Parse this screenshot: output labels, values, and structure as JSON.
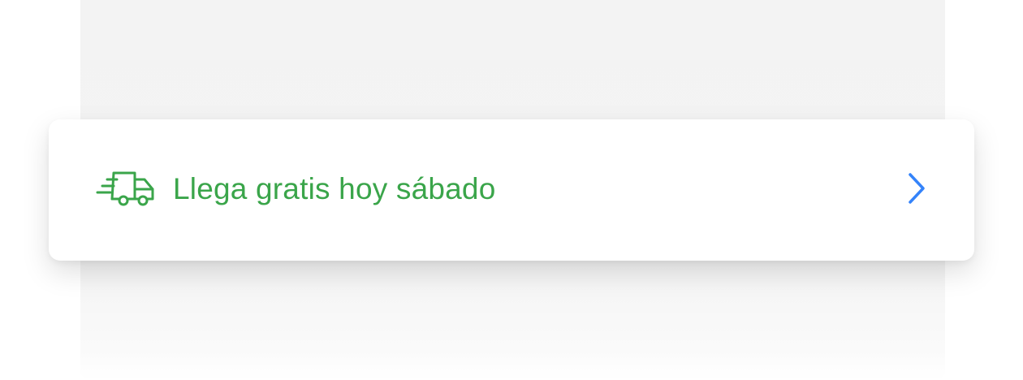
{
  "shipping": {
    "label": "Llega gratis hoy sábado",
    "icon": "fast-delivery-truck-icon",
    "action_icon": "chevron-right-icon"
  },
  "colors": {
    "accent_green": "#3aa54a",
    "chevron_blue": "#3483fa",
    "background_card": "#f3f3f3",
    "card": "#ffffff"
  }
}
